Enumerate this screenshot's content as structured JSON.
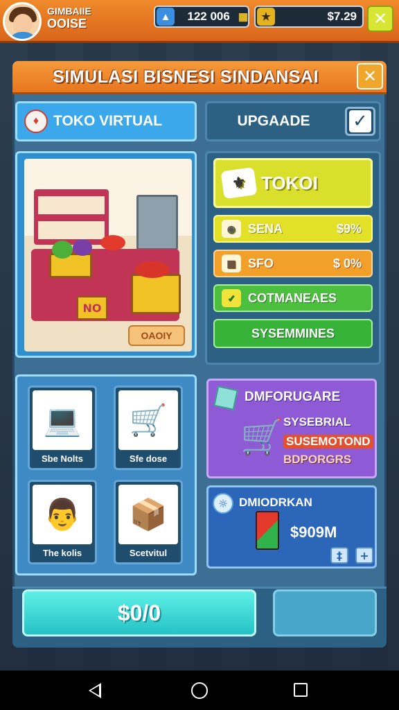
{
  "player": {
    "name_line1": "GIMBAIIE",
    "name_line2": "OOISE"
  },
  "stats": {
    "coins": "122 006",
    "money": "$7.29"
  },
  "colors": {
    "accent_orange": "#e7761e",
    "panel_blue": "#3d6f95",
    "buy_cyan": "#25c2c6"
  },
  "window": {
    "title": "SIMULASI BISNESI SINDANSAI"
  },
  "tabs": {
    "left_label": "TOKO VIRTUAL",
    "right_label": "UPGAADE"
  },
  "shop_preview": {
    "quantity_button": "OAOIY",
    "sign_text": "NO"
  },
  "menu": {
    "main_label": "TOKOI",
    "items": [
      {
        "label": "SENA",
        "value": "$9%"
      },
      {
        "label": "SFO",
        "value": "$ 0%"
      },
      {
        "label": "COTMANEAES",
        "value": ""
      },
      {
        "label": "SYSEMMINES",
        "value": ""
      }
    ]
  },
  "cards": [
    {
      "caption": "Sbe Nolts",
      "icon": "computer-icon"
    },
    {
      "caption": "Sfe dose",
      "icon": "cart-icon"
    },
    {
      "caption": "The kolis",
      "icon": "worker-icon"
    },
    {
      "caption": "Scetvitul",
      "icon": "box-icon"
    }
  ],
  "upgrade_card": {
    "title": "DMFORUGARE",
    "line1": "SYSEBRIAL",
    "line2": "SUSEMOTOND",
    "line3": "BDPORGRS"
  },
  "money_card": {
    "title": "DMIODRKAN",
    "amount": "$909M"
  },
  "buy_button": {
    "label": "$0/0"
  }
}
